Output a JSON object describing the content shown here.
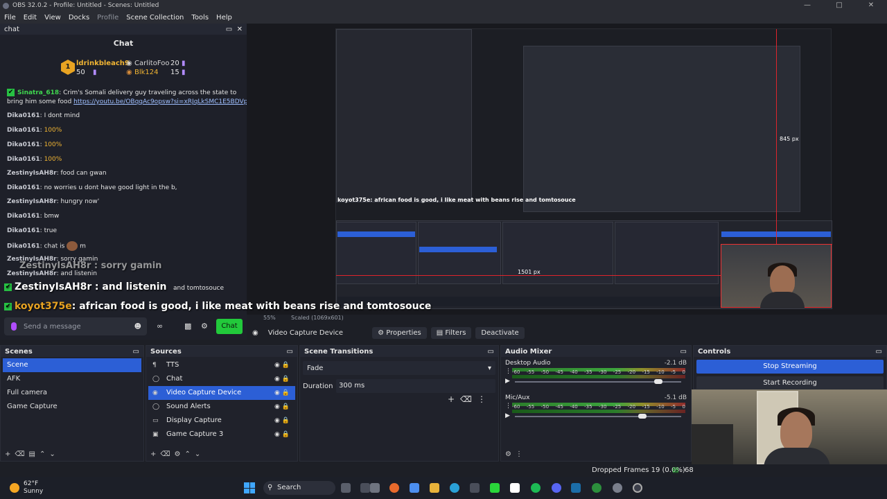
{
  "titlebar": {
    "title": "OBS 32.0.2 - Profile: Untitled - Scenes: Untitled"
  },
  "menu": [
    "File",
    "Edit",
    "View",
    "Docks",
    "Profile",
    "Scene Collection",
    "Tools",
    "Help"
  ],
  "chat_dock": {
    "dock_title": "chat",
    "header": "Chat",
    "leaderboard": [
      {
        "name": "ldrinkbleach9",
        "count": "50"
      },
      {
        "name": "CarlitoFoo",
        "count": "20"
      },
      {
        "name": "Blk124",
        "count": "15"
      }
    ],
    "messages": [
      {
        "user": "Sinatra_618",
        "text": "Crim's Somali delivery guy traveling across the state to",
        "cont": "bring him some food",
        "link": "https://youtu.be/OBqqAc9opsw?si=xRJqLkSMC1E5BDVp"
      },
      {
        "user": "Dika0161",
        "text": "I dont mind"
      },
      {
        "user": "Dika0161",
        "text": "100%"
      },
      {
        "user": "Dika0161",
        "text": "100%"
      },
      {
        "user": "Dika0161",
        "text": "100%"
      },
      {
        "user": "ZestinyIsAH8r",
        "text": "food can gwan"
      },
      {
        "user": "Dika0161",
        "text": "no worries u dont have good light in the b,"
      },
      {
        "user": "ZestinyIsAH8r",
        "text": "hungry now'"
      },
      {
        "user": "Dika0161",
        "text": "bmw"
      },
      {
        "user": "Dika0161",
        "text": "true"
      },
      {
        "user": "Dika0161",
        "text": "chat is",
        "tail": "m"
      },
      {
        "user": "ZestinyIsAH8r",
        "text": "sorry gamin"
      },
      {
        "user": "ZestinyIsAH8r",
        "text": "and listenin"
      }
    ],
    "overlay_sorry": "ZestinyIsAH8r : sorry gamin",
    "overlay_listen_user": "ZestinyIsAH8r",
    "overlay_listen_text": ": and listenin",
    "overlay_tomto_small": "and tomtosouce",
    "overlay_food_user": "koyot375e",
    "overlay_food_text": ": african food is good, i like meat with beans rise and tomtosouce",
    "input_placeholder": "Send a message",
    "send_label": "Chat"
  },
  "preview": {
    "scale_text": "55%",
    "scaled_text": "Scaled (1069x601)",
    "px_845": "845 px",
    "px_1501": "1501 px",
    "nested_food_text": "koyot375e: african food is good, i like meat with beans rise and tomtosouce"
  },
  "source_toolbar": {
    "source_name": "Video Capture Device",
    "properties": "Properties",
    "filters": "Filters",
    "deactivate": "Deactivate"
  },
  "scenes": {
    "title": "Scenes",
    "items": [
      "Scene",
      "AFK",
      "Full camera",
      "Game Capture"
    ]
  },
  "sources": {
    "title": "Sources",
    "items": [
      "TTS",
      "Chat",
      "Video Capture Device",
      "Sound Alerts",
      "Display Capture",
      "Game Capture 3"
    ]
  },
  "transitions": {
    "title": "Scene Transitions",
    "selected": "Fade",
    "duration_label": "Duration",
    "duration_value": "300 ms"
  },
  "mixer": {
    "title": "Audio Mixer",
    "channels": [
      {
        "name": "Desktop Audio",
        "db": "-2.1 dB",
        "volume": 0.88
      },
      {
        "name": "Mic/Aux",
        "db": "-5.1 dB",
        "volume": 0.78
      }
    ],
    "scale": [
      "-60",
      "-55",
      "-50",
      "-45",
      "-40",
      "-35",
      "-30",
      "-25",
      "-20",
      "-15",
      "-10",
      "-5",
      "0"
    ]
  },
  "controls": {
    "title": "Controls",
    "stop_streaming": "Stop Streaming",
    "start_recording": "Start Recording"
  },
  "status": {
    "dropped": "Dropped Frames 19 (0.0%)",
    "tail": "68"
  },
  "taskbar": {
    "temp": "62°F",
    "condition": "Sunny",
    "search": "Search"
  }
}
